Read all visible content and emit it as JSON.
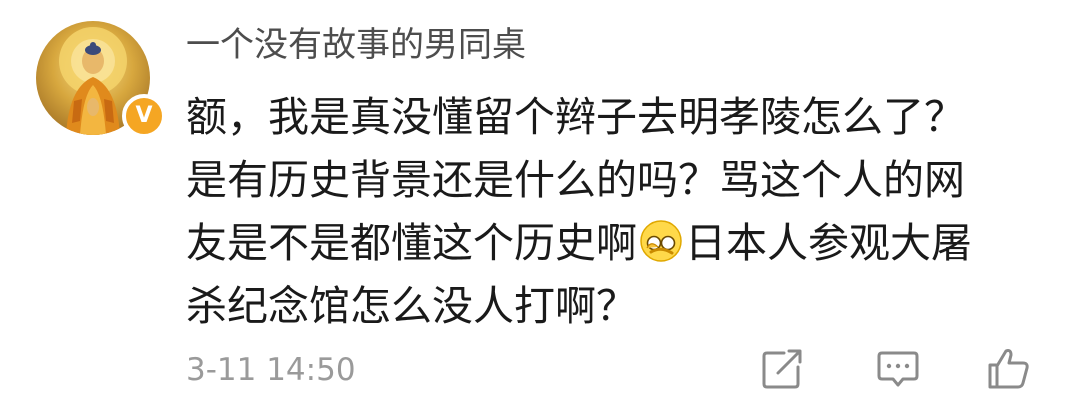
{
  "comment": {
    "username": "一个没有故事的男同桌",
    "verified_badge": "V",
    "verified_color": "#f5a623",
    "content_lines": [
      "额，我是真没懂留个辫子去明孝陵怎么了？",
      "是有历史背景还是什么的吗？骂这个人的网",
      "友是不是都懂这个历史啊",
      "日本人参观大屠",
      "杀纪念馆怎么没人打啊？"
    ],
    "emoji": "facepalm-emoji",
    "timestamp": "3-11 14:50",
    "actions": {
      "share_icon": "edit-share-icon",
      "comment_icon": "comment-icon",
      "like_icon": "thumbs-up-icon"
    }
  }
}
